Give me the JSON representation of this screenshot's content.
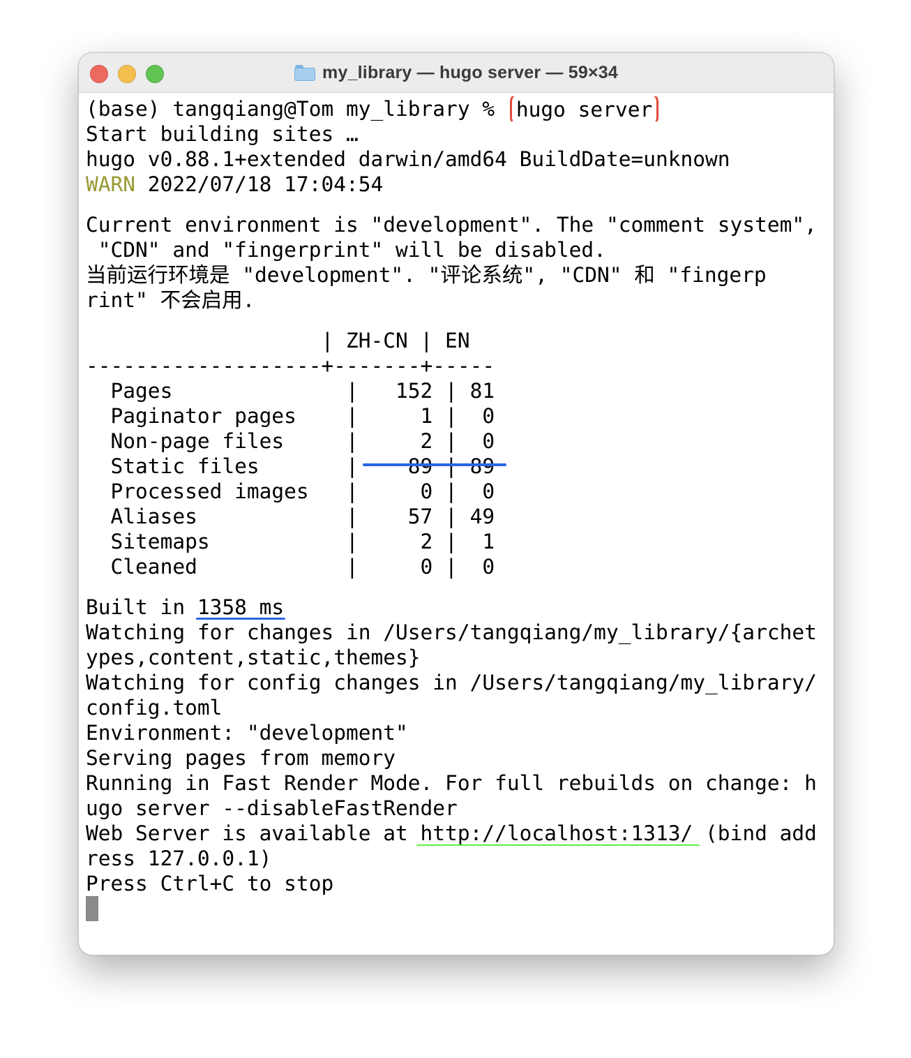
{
  "window": {
    "title": "my_library — hugo server — 59×34"
  },
  "terminal": {
    "prompt": "(base) tangqiang@Tom my_library % ",
    "command": "hugo server",
    "lines_top": [
      "Start building sites …",
      "hugo v0.88.1+extended darwin/amd64 BuildDate=unknown"
    ],
    "warn_label": "WARN",
    "warn_text": " 2022/07/18 17:04:54",
    "env_lines": [
      "Current environment is \"development\". The \"comment system\",",
      " \"CDN\" and \"fingerprint\" will be disabled.",
      "当前运行环境是 \"development\". \"评论系统\", \"CDN\" 和 \"fingerp",
      "rint\" 不会启用."
    ],
    "table": {
      "header": "                   | ZH-CN | EN",
      "separator": "-------------------+-------+-----",
      "rows": [
        "  Pages              |   152 | 81",
        "  Paginator pages    |     1 |  0",
        "  Non-page files     |     2 |  0",
        "  Static files       |    89 | 89",
        "  Processed images   |     0 |  0",
        "  Aliases            |    57 | 49",
        "  Sitemaps           |     2 |  1",
        "  Cleaned            |     0 |  0"
      ]
    },
    "built_prefix": "Built in ",
    "built_time": "1358 ms",
    "watch_lines": [
      "Watching for changes in /Users/tangqiang/my_library/{archet",
      "ypes,content,static,themes}",
      "Watching for config changes in /Users/tangqiang/my_library/",
      "config.toml",
      "Environment: \"development\"",
      "Serving pages from memory",
      "Running in Fast Render Mode. For full rebuilds on change: h",
      "ugo server --disableFastRender"
    ],
    "web_prefix": "Web Server is available at ",
    "web_url": "http://localhost:1313/",
    "web_suffix": " (bind add",
    "web_line2": "ress 127.0.0.1)",
    "stop_line": "Press Ctrl+C to stop"
  }
}
